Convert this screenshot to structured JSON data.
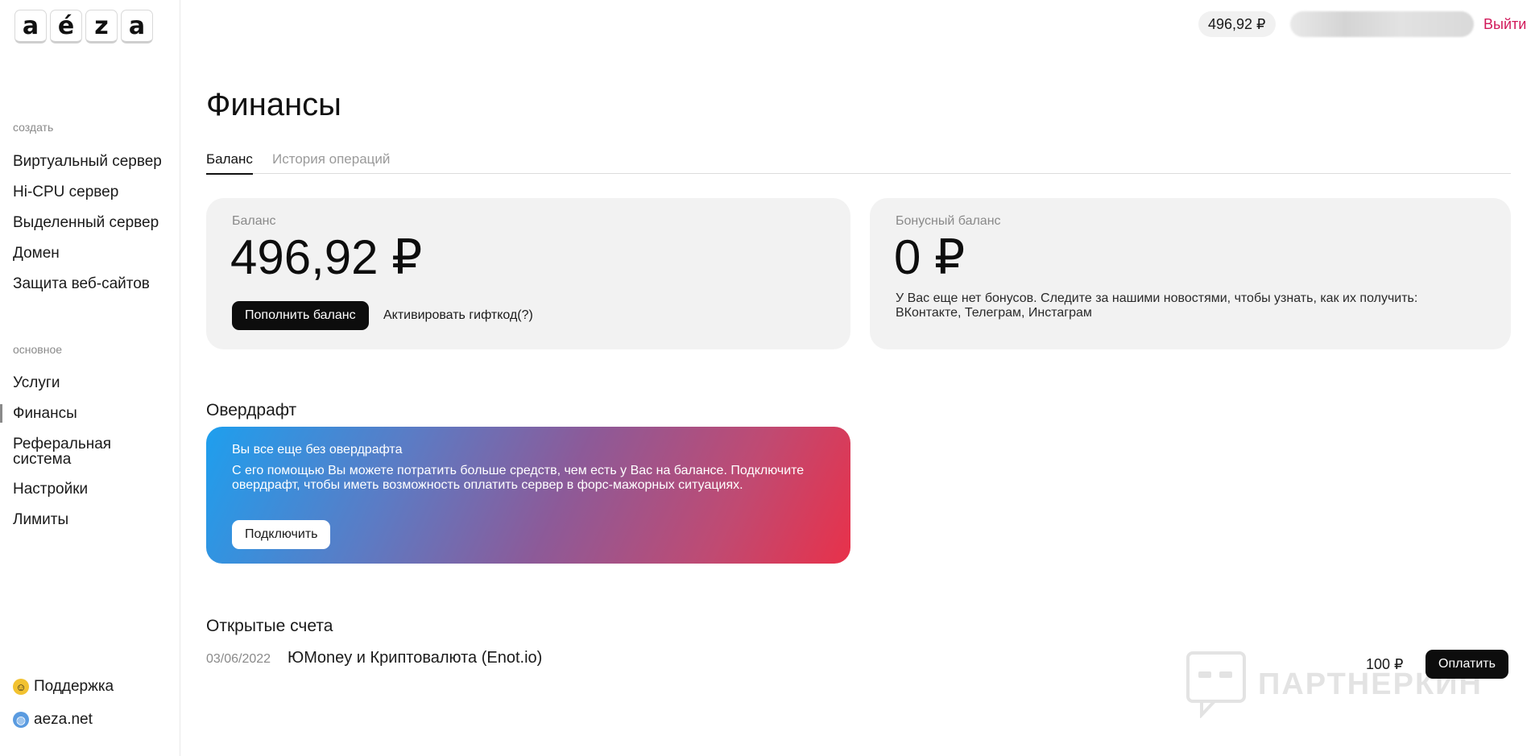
{
  "logo": {
    "letters": [
      "a",
      "é",
      "z",
      "a"
    ]
  },
  "sidebar": {
    "section_create": "создать",
    "create_items": [
      {
        "label": "Виртуальный сервер"
      },
      {
        "label": "Hi-CPU сервер"
      },
      {
        "label": "Выделенный сервер"
      },
      {
        "label": "Домен"
      },
      {
        "label": "Защита веб-сайтов"
      }
    ],
    "section_main": "основное",
    "main_items": [
      {
        "label": "Услуги"
      },
      {
        "label": "Финансы"
      },
      {
        "label": "Реферальная система"
      },
      {
        "label": "Настройки"
      },
      {
        "label": "Лимиты"
      }
    ],
    "support": "Поддержка",
    "site": "aeza.net"
  },
  "header": {
    "balance": "496,92 ₽",
    "logout": "Выйти"
  },
  "page": {
    "title": "Финансы",
    "tabs": [
      {
        "label": "Баланс"
      },
      {
        "label": "История операций"
      }
    ]
  },
  "balance_card": {
    "label": "Баланс",
    "amount": "496,92 ₽",
    "topup_button": "Пополнить баланс",
    "gift_link": "Активировать гифткод(?)"
  },
  "bonus_card": {
    "label": "Бонусный баланс",
    "amount": "0 ₽",
    "text": "У Вас еще нет бонусов. Следите за нашими новостями, чтобы узнать, как их получить:",
    "links": "ВКонтакте, Телеграм, Инстаграм"
  },
  "overdraft": {
    "section_title": "Овердрафт",
    "heading": "Вы все еще без овердрафта",
    "body": "С его помощью Вы можете потратить больше средств, чем есть у Вас на балансе. Подключите овердрафт, чтобы иметь возможность оплатить сервер в форс-мажорных ситуациях.",
    "button": "Подключить"
  },
  "invoices": {
    "section_title": "Открытые счета",
    "rows": [
      {
        "date": "03/06/2022",
        "name": "ЮMoney и Криптовалюта (Enot.io)",
        "amount": "100 ₽",
        "pay_button": "Оплатить"
      }
    ]
  },
  "watermark": {
    "text": "ПАРТНЕРКИН"
  }
}
